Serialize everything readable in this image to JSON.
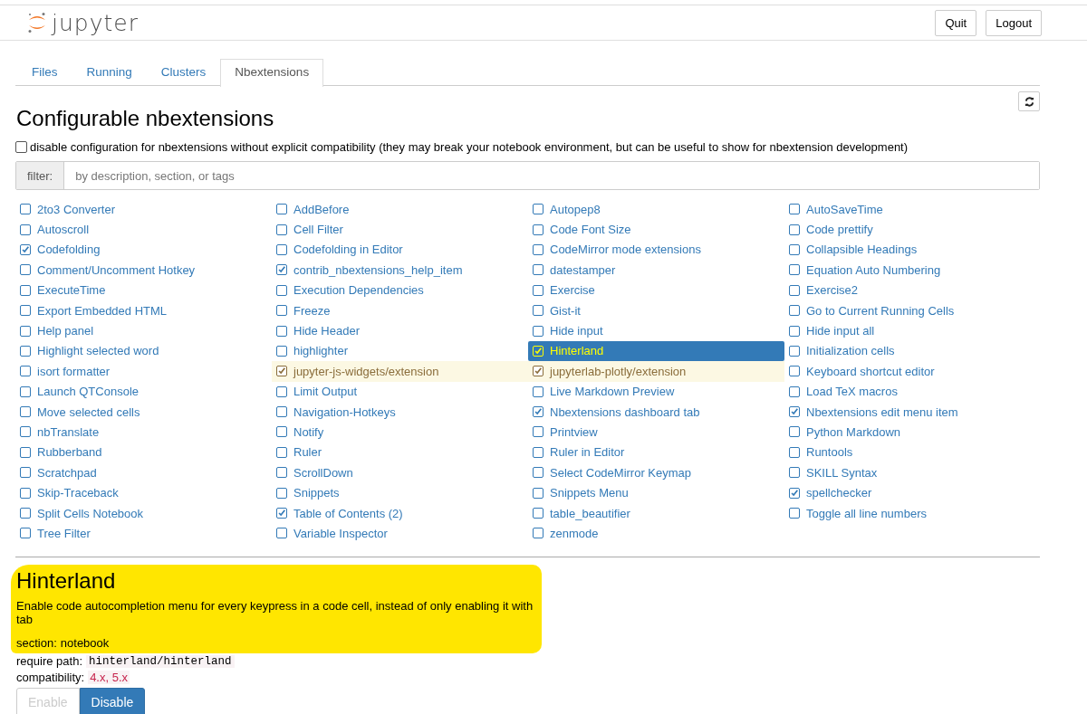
{
  "header": {
    "logo_text": "jupyter",
    "buttons": [
      "Quit",
      "Logout"
    ]
  },
  "tabs": [
    {
      "label": "Files",
      "selected": false
    },
    {
      "label": "Running",
      "selected": false
    },
    {
      "label": "Clusters",
      "selected": false
    },
    {
      "label": "Nbextensions",
      "selected": true
    }
  ],
  "page_title": "Configurable nbextensions",
  "compat_option": {
    "label": "disable configuration for nbextensions without explicit compatibility (they may break your notebook environment, but can be useful to show for nbextension development)",
    "checked": false
  },
  "filter": {
    "label": "filter:",
    "placeholder": "by description, section, or tags"
  },
  "extensions": [
    {
      "label": "2to3 Converter",
      "checked": false,
      "selected": false,
      "warning": false
    },
    {
      "label": "AddBefore",
      "checked": false,
      "selected": false,
      "warning": false
    },
    {
      "label": "Autopep8",
      "checked": false,
      "selected": false,
      "warning": false
    },
    {
      "label": "AutoSaveTime",
      "checked": false,
      "selected": false,
      "warning": false
    },
    {
      "label": "Autoscroll",
      "checked": false,
      "selected": false,
      "warning": false
    },
    {
      "label": "Cell Filter",
      "checked": false,
      "selected": false,
      "warning": false
    },
    {
      "label": "Code Font Size",
      "checked": false,
      "selected": false,
      "warning": false
    },
    {
      "label": "Code prettify",
      "checked": false,
      "selected": false,
      "warning": false
    },
    {
      "label": "Codefolding",
      "checked": true,
      "selected": false,
      "warning": false
    },
    {
      "label": "Codefolding in Editor",
      "checked": false,
      "selected": false,
      "warning": false
    },
    {
      "label": "CodeMirror mode extensions",
      "checked": false,
      "selected": false,
      "warning": false
    },
    {
      "label": "Collapsible Headings",
      "checked": false,
      "selected": false,
      "warning": false
    },
    {
      "label": "Comment/Uncomment Hotkey",
      "checked": false,
      "selected": false,
      "warning": false
    },
    {
      "label": "contrib_nbextensions_help_item",
      "checked": true,
      "selected": false,
      "warning": false
    },
    {
      "label": "datestamper",
      "checked": false,
      "selected": false,
      "warning": false
    },
    {
      "label": "Equation Auto Numbering",
      "checked": false,
      "selected": false,
      "warning": false
    },
    {
      "label": "ExecuteTime",
      "checked": false,
      "selected": false,
      "warning": false
    },
    {
      "label": "Execution Dependencies",
      "checked": false,
      "selected": false,
      "warning": false
    },
    {
      "label": "Exercise",
      "checked": false,
      "selected": false,
      "warning": false
    },
    {
      "label": "Exercise2",
      "checked": false,
      "selected": false,
      "warning": false
    },
    {
      "label": "Export Embedded HTML",
      "checked": false,
      "selected": false,
      "warning": false
    },
    {
      "label": "Freeze",
      "checked": false,
      "selected": false,
      "warning": false
    },
    {
      "label": "Gist-it",
      "checked": false,
      "selected": false,
      "warning": false
    },
    {
      "label": "Go to Current Running Cells",
      "checked": false,
      "selected": false,
      "warning": false
    },
    {
      "label": "Help panel",
      "checked": false,
      "selected": false,
      "warning": false
    },
    {
      "label": "Hide Header",
      "checked": false,
      "selected": false,
      "warning": false
    },
    {
      "label": "Hide input",
      "checked": false,
      "selected": false,
      "warning": false
    },
    {
      "label": "Hide input all",
      "checked": false,
      "selected": false,
      "warning": false
    },
    {
      "label": "Highlight selected word",
      "checked": false,
      "selected": false,
      "warning": false
    },
    {
      "label": "highlighter",
      "checked": false,
      "selected": false,
      "warning": false
    },
    {
      "label": "Hinterland",
      "checked": true,
      "selected": true,
      "warning": false
    },
    {
      "label": "Initialization cells",
      "checked": false,
      "selected": false,
      "warning": false
    },
    {
      "label": "isort formatter",
      "checked": false,
      "selected": false,
      "warning": false
    },
    {
      "label": "jupyter-js-widgets/extension",
      "checked": true,
      "selected": false,
      "warning": true
    },
    {
      "label": "jupyterlab-plotly/extension",
      "checked": true,
      "selected": false,
      "warning": true
    },
    {
      "label": "Keyboard shortcut editor",
      "checked": false,
      "selected": false,
      "warning": false
    },
    {
      "label": "Launch QTConsole",
      "checked": false,
      "selected": false,
      "warning": false
    },
    {
      "label": "Limit Output",
      "checked": false,
      "selected": false,
      "warning": false
    },
    {
      "label": "Live Markdown Preview",
      "checked": false,
      "selected": false,
      "warning": false
    },
    {
      "label": "Load TeX macros",
      "checked": false,
      "selected": false,
      "warning": false
    },
    {
      "label": "Move selected cells",
      "checked": false,
      "selected": false,
      "warning": false
    },
    {
      "label": "Navigation-Hotkeys",
      "checked": false,
      "selected": false,
      "warning": false
    },
    {
      "label": "Nbextensions dashboard tab",
      "checked": true,
      "selected": false,
      "warning": false
    },
    {
      "label": "Nbextensions edit menu item",
      "checked": true,
      "selected": false,
      "warning": false
    },
    {
      "label": "nbTranslate",
      "checked": false,
      "selected": false,
      "warning": false
    },
    {
      "label": "Notify",
      "checked": false,
      "selected": false,
      "warning": false
    },
    {
      "label": "Printview",
      "checked": false,
      "selected": false,
      "warning": false
    },
    {
      "label": "Python Markdown",
      "checked": false,
      "selected": false,
      "warning": false
    },
    {
      "label": "Rubberband",
      "checked": false,
      "selected": false,
      "warning": false
    },
    {
      "label": "Ruler",
      "checked": false,
      "selected": false,
      "warning": false
    },
    {
      "label": "Ruler in Editor",
      "checked": false,
      "selected": false,
      "warning": false
    },
    {
      "label": "Runtools",
      "checked": false,
      "selected": false,
      "warning": false
    },
    {
      "label": "Scratchpad",
      "checked": false,
      "selected": false,
      "warning": false
    },
    {
      "label": "ScrollDown",
      "checked": false,
      "selected": false,
      "warning": false
    },
    {
      "label": "Select CodeMirror Keymap",
      "checked": false,
      "selected": false,
      "warning": false
    },
    {
      "label": "SKILL Syntax",
      "checked": false,
      "selected": false,
      "warning": false
    },
    {
      "label": "Skip-Traceback",
      "checked": false,
      "selected": false,
      "warning": false
    },
    {
      "label": "Snippets",
      "checked": false,
      "selected": false,
      "warning": false
    },
    {
      "label": "Snippets Menu",
      "checked": false,
      "selected": false,
      "warning": false
    },
    {
      "label": "spellchecker",
      "checked": true,
      "selected": false,
      "warning": false
    },
    {
      "label": "Split Cells Notebook",
      "checked": false,
      "selected": false,
      "warning": false
    },
    {
      "label": "Table of Contents (2)",
      "checked": true,
      "selected": false,
      "warning": false
    },
    {
      "label": "table_beautifier",
      "checked": false,
      "selected": false,
      "warning": false
    },
    {
      "label": "Toggle all line numbers",
      "checked": false,
      "selected": false,
      "warning": false
    },
    {
      "label": "Tree Filter",
      "checked": false,
      "selected": false,
      "warning": false
    },
    {
      "label": "Variable Inspector",
      "checked": false,
      "selected": false,
      "warning": false
    },
    {
      "label": "zenmode",
      "checked": false,
      "selected": false,
      "warning": false
    }
  ],
  "details": {
    "highlighted": true,
    "title": "Hinterland",
    "description": "Enable code autocompletion menu for every keypress in a code cell, instead of only enabling it with tab",
    "section_label": "section:",
    "section": "notebook",
    "require_label": "require path:",
    "require_path": "hinterland/hinterland",
    "compat_label": "compatibility:",
    "compatibility": "4.x, 5.x",
    "buttons": [
      {
        "label": "Enable",
        "disabled": true
      },
      {
        "label": "Disable",
        "disabled": false
      }
    ]
  }
}
